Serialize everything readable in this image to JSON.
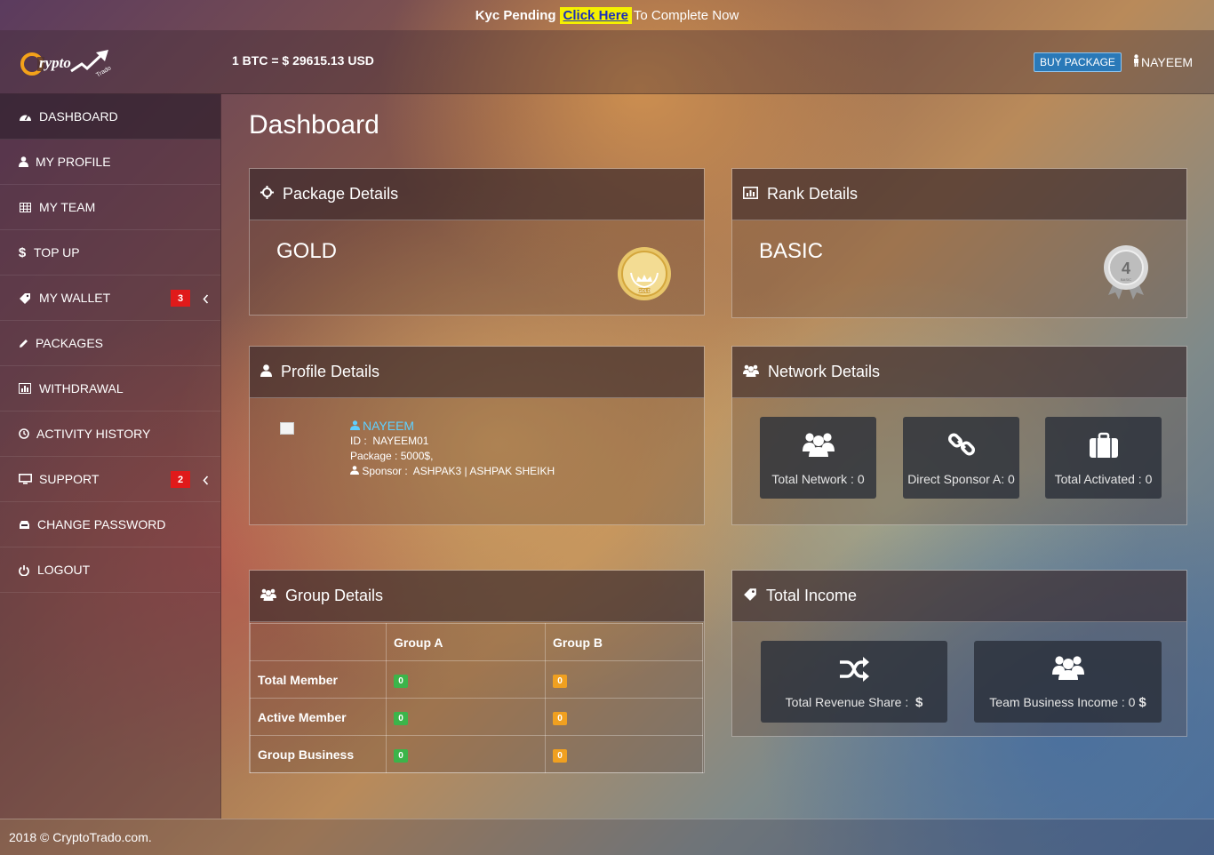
{
  "kyc": {
    "status": "Kyc Pending",
    "link": "Click Here",
    "rest": "To Complete Now"
  },
  "header": {
    "logo_text": "Crypto",
    "logo_subtext": "Trado",
    "btc_rate": "1 BTC = $ 29615.13 USD",
    "buy_button": "BUY PACKAGE",
    "user": "NAYEEM"
  },
  "sidebar": {
    "items": [
      {
        "label": "DASHBOARD",
        "icon": "dashboard-icon",
        "active": true
      },
      {
        "label": "MY PROFILE",
        "icon": "user-icon"
      },
      {
        "label": "MY TEAM",
        "icon": "table-icon"
      },
      {
        "label": "TOP UP",
        "icon": "dollar-icon"
      },
      {
        "label": "MY WALLET",
        "icon": "tag-icon",
        "badge": "3"
      },
      {
        "label": "PACKAGES",
        "icon": "pencil-icon"
      },
      {
        "label": "WITHDRAWAL",
        "icon": "bar-chart-icon"
      },
      {
        "label": "ACTIVITY HISTORY",
        "icon": "clock-icon"
      },
      {
        "label": "SUPPORT",
        "icon": "monitor-icon",
        "badge": "2"
      },
      {
        "label": "CHANGE PASSWORD",
        "icon": "inbox-icon"
      },
      {
        "label": "LOGOUT",
        "icon": "power-icon"
      }
    ]
  },
  "main": {
    "title": "Dashboard",
    "package": {
      "heading": "Package Details",
      "value": "GOLD",
      "medal_text": "GOLD"
    },
    "rank": {
      "heading": "Rank Details",
      "value": "BASIC",
      "medal_number": "4",
      "medal_text": "BASIC"
    },
    "profile": {
      "heading": "Profile Details",
      "name": "NAYEEM",
      "id_label": "ID :",
      "id_value": "NAYEEM01",
      "package_label": "Package :",
      "package_value": "5000$,",
      "sponsor_label": "Sponsor :",
      "sponsor_value": "ASHPAK3 | ASHPAK SHEIKH"
    },
    "network": {
      "heading": "Network Details",
      "tiles": [
        "Total Network : 0",
        "Direct Sponsor A: 0",
        "Total Activated : 0"
      ]
    },
    "group": {
      "heading": "Group Details",
      "columns": [
        "",
        "Group A",
        "Group B"
      ],
      "rows": [
        {
          "label": "Total Member",
          "a": "0",
          "b": "0"
        },
        {
          "label": "Active Member",
          "a": "0",
          "b": "0"
        },
        {
          "label": "Group Business",
          "a": "0",
          "b": "0"
        }
      ]
    },
    "income": {
      "heading": "Total Income",
      "tiles": [
        {
          "label": "Total Revenue Share :",
          "value": "$"
        },
        {
          "label": "Team Business Income : 0",
          "value": "$"
        }
      ]
    }
  },
  "footer": {
    "text": "2018 © CryptoTrado.com."
  },
  "colors": {
    "badge": "#e01a1a",
    "link_bg": "#f5f000",
    "name": "#5fd0ff",
    "green": "#3cb44a",
    "orange": "#f0a020",
    "button": "#2a79b8"
  }
}
